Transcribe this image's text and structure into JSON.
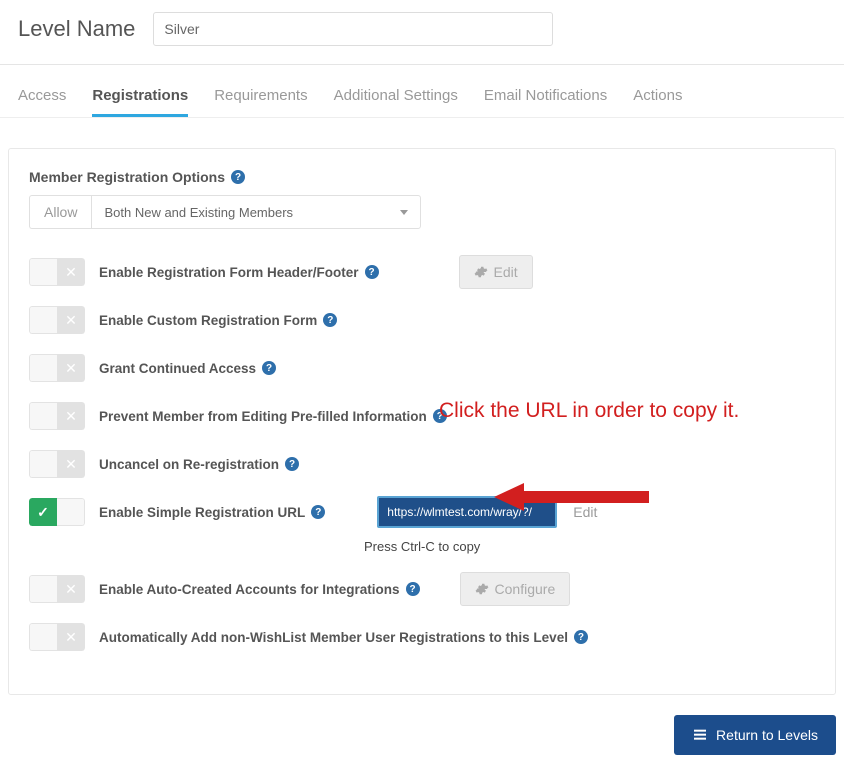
{
  "header": {
    "label": "Level Name",
    "value": "Silver"
  },
  "tabs": {
    "items": [
      {
        "label": "Access",
        "active": false
      },
      {
        "label": "Registrations",
        "active": true
      },
      {
        "label": "Requirements",
        "active": false
      },
      {
        "label": "Additional Settings",
        "active": false
      },
      {
        "label": "Email Notifications",
        "active": false
      },
      {
        "label": "Actions",
        "active": false
      }
    ]
  },
  "section": {
    "title": "Member Registration Options",
    "allow_label": "Allow",
    "allow_value": "Both New and Existing Members"
  },
  "options": [
    {
      "label": "Enable Registration Form Header/Footer",
      "state": "off",
      "action": "edit"
    },
    {
      "label": "Enable Custom Registration Form",
      "state": "off"
    },
    {
      "label": "Grant Continued Access",
      "state": "off"
    },
    {
      "label": "Prevent Member from Editing Pre-filled Information",
      "state": "off"
    },
    {
      "label": "Uncancel on Re-registration",
      "state": "off"
    },
    {
      "label": "Enable Simple Registration URL",
      "state": "on",
      "url": "https://wlmtest.com/wray/?/",
      "edit": "Edit",
      "hint": "Press Ctrl-C to copy"
    },
    {
      "label": "Enable Auto-Created Accounts for Integrations",
      "state": "off",
      "action": "configure"
    },
    {
      "label": "Automatically Add non-WishList Member User Registrations to this Level",
      "state": "off"
    }
  ],
  "buttons": {
    "edit": "Edit",
    "configure": "Configure",
    "return": "Return to Levels"
  },
  "annotation": {
    "text": "Click the URL in order to copy it."
  }
}
